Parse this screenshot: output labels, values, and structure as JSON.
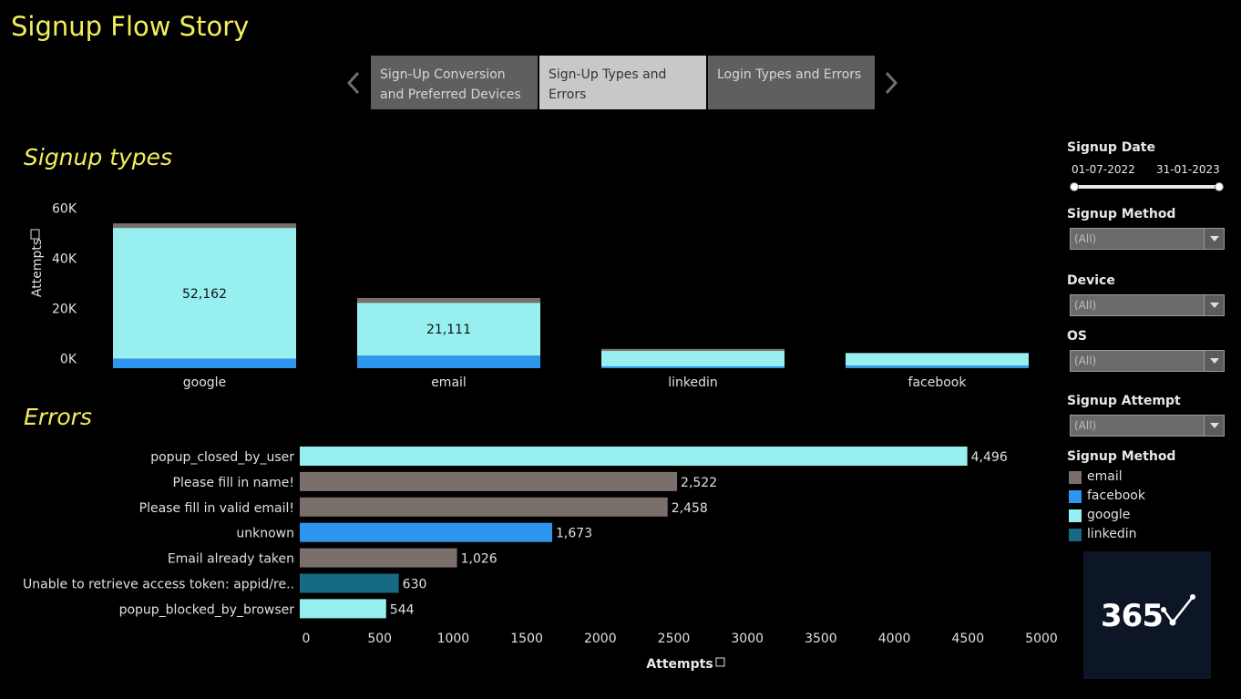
{
  "story": {
    "title": "Signup Flow Story",
    "tabs": [
      {
        "label": "Sign-Up Conversion and Preferred Devices",
        "lines": [
          "Sign-Up Conversion",
          "and Preferred Devices"
        ]
      },
      {
        "label": "Sign-Up Types and Errors",
        "lines": [
          "Sign-Up Types and",
          "Errors"
        ]
      },
      {
        "label": "Login Types and Errors",
        "lines": [
          "Login Types and Errors"
        ]
      }
    ],
    "active_tab": 1
  },
  "colors": {
    "email": "#7a6f6b",
    "facebook": "#2e96ee",
    "google": "#97f0ef",
    "linkedin": "#176a83",
    "title": "#f2ef5a"
  },
  "sections": {
    "signup_types": "Signup types",
    "errors": "Errors"
  },
  "chart_data": [
    {
      "type": "bar",
      "stacked": true,
      "title": "Signup types",
      "ylabel": "Attempts",
      "categories": [
        "google",
        "email",
        "linkedin",
        "facebook"
      ],
      "ylim": [
        -3800,
        66000
      ],
      "yticks": [
        0,
        20000,
        40000,
        60000
      ],
      "ytick_labels": [
        "0K",
        "20K",
        "40K",
        "60K"
      ],
      "series": [
        {
          "name": "facebook",
          "values": [
            3800,
            5000,
            700,
            1000
          ]
        },
        {
          "name": "google",
          "values": [
            52162,
            21111,
            6200,
            5000
          ]
        },
        {
          "name": "email",
          "values": [
            1800,
            1900,
            800,
            100
          ]
        }
      ],
      "data_labels": [
        "52,162",
        "21,111",
        "",
        ""
      ]
    },
    {
      "type": "bar",
      "orientation": "horizontal",
      "title": "Errors",
      "xlabel": "Attempts",
      "categories": [
        "popup_closed_by_user",
        "Please fill in name!",
        "Please fill in valid email!",
        "unknown",
        "Email already taken",
        "Unable to retrieve access token: appid/re..",
        "popup_blocked_by_browser"
      ],
      "values": [
        4496,
        2522,
        2458,
        1673,
        1026,
        630,
        544
      ],
      "value_labels": [
        "4,496",
        "2,522",
        "2,458",
        "1,673",
        "1,026",
        "630",
        "544"
      ],
      "bar_methods": [
        "google",
        "email",
        "email",
        "facebook",
        "email",
        "linkedin",
        "google"
      ],
      "xlim": [
        -40,
        5000
      ],
      "xticks": [
        0,
        500,
        1000,
        1500,
        2000,
        2500,
        3000,
        3500,
        4000,
        4500,
        5000
      ],
      "xtick_labels": [
        "0",
        "500",
        "1000",
        "1500",
        "2000",
        "2500",
        "3000",
        "3500",
        "4000",
        "4500",
        "5000"
      ]
    }
  ],
  "filters": {
    "signup_date": {
      "label": "Signup Date",
      "start": "01-07-2022",
      "end": "31-01-2023"
    },
    "signup_method": {
      "label": "Signup Method",
      "value": "(All)"
    },
    "device": {
      "label": "Device",
      "value": "(All)"
    },
    "os": {
      "label": "OS",
      "value": "(All)"
    },
    "signup_attempt": {
      "label": "Signup Attempt",
      "value": "(All)"
    }
  },
  "legend": {
    "title": "Signup Method",
    "items": [
      {
        "label": "email",
        "color": "#7a6f6b"
      },
      {
        "label": "facebook",
        "color": "#2e96ee"
      },
      {
        "label": "google",
        "color": "#97f0ef"
      },
      {
        "label": "linkedin",
        "color": "#176a83"
      }
    ]
  },
  "logo": {
    "text": "365"
  }
}
